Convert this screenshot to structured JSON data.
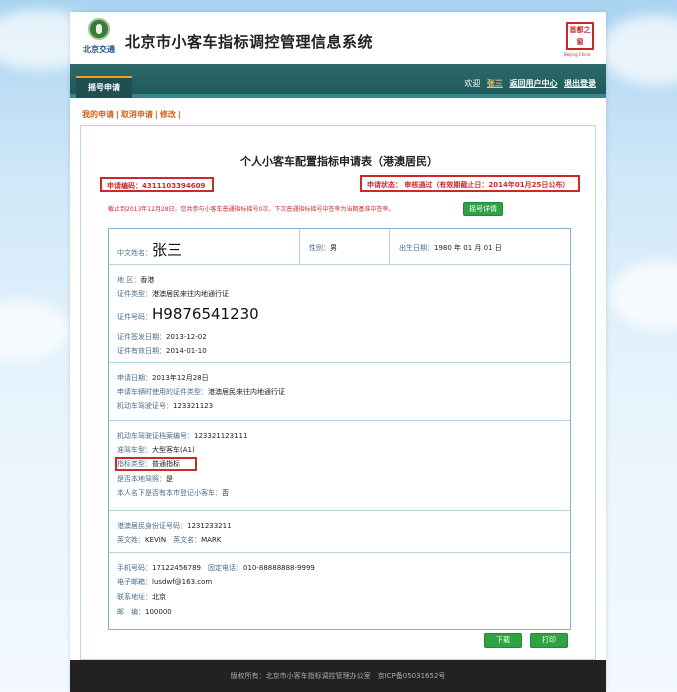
{
  "header": {
    "logo_text": "北京交通",
    "system_title": "北京市小客车指标调控管理信息系统",
    "seal_text": "首都之窗",
    "seal_sub": "Beijing China"
  },
  "nav": {
    "active_tab": "摇号申请",
    "welcome": "欢迎",
    "username": "张三",
    "return_link": "返回用户中心",
    "logout_link": "退出登录"
  },
  "breadcrumb": {
    "my_application": "我的申请",
    "cancel_application": "取消申请",
    "modify": "修改"
  },
  "form": {
    "title": "个人小客车配置指标申请表（港澳居民）",
    "application_no": "申请编码：4311103394609",
    "status": "申请状态：  审核通过（有效期截止日：2014年01月25日公布）",
    "notice": "截止到2013年12月28日，您共参与小客车普通指标摇号0次，下次普通指标摇号中签率为当期基准中签率。",
    "detail_button": "摇号详情"
  },
  "section1": {
    "name_label": "中文姓名：",
    "name_value": "张三",
    "gender_label": "性别：",
    "gender_value": "男",
    "birth_label": "出生日期：",
    "birth_value": "1980 年 01 月 01 日"
  },
  "section2": {
    "region_label": "地 区：",
    "region_value": "香港",
    "doc_type_label": "证件类型：",
    "doc_type_value": "港澳居民来往内地通行证",
    "doc_no_label": "证件号码：",
    "doc_no_value": "H9876541230",
    "issue_date_label": "证件签发日期：",
    "issue_date_value": "2013-12-02",
    "expire_date_label": "证件有效日期：",
    "expire_date_value": "2014-01-10"
  },
  "section3": {
    "apply_date_label": "申请日期：",
    "apply_date_value": "2013年12月28日",
    "used_doc_label": "申请车辆时使用的证件类型：",
    "used_doc_value": "港澳居民来往内地通行证",
    "license_label": "机动车驾驶证号：",
    "license_value": "123321123"
  },
  "section4": {
    "vehicle_license_label": "机动车驾驶证档案编号：",
    "vehicle_license_value": "123321123111",
    "car_type_label": "准驾车型：",
    "car_type_value": "大型客车(A1)",
    "quota_type_label": "指标类型：",
    "quota_type_value": "普通指标",
    "local_label": "是否本地驾照：",
    "local_value": "是",
    "has_car_label": "本人名下是否有本市登记小客车：",
    "has_car_value": "否"
  },
  "section5": {
    "pass_label": "港澳居民身份证号码：",
    "pass_value": "1231233211",
    "en_name_label": "英文姓：",
    "en_name_value": "KEVIN",
    "en_given_label": "英文名：",
    "en_given_value": "MARK"
  },
  "section6": {
    "mobile_label": "手机号码：",
    "mobile_value": "17122456789",
    "phone_label": "固定电话：",
    "phone_value": "010-88888888-9999",
    "email_label": "电子邮箱：",
    "email_value": "lusdwf@163.com",
    "address_label": "联系地址：",
    "address_value": "北京",
    "postcode_label": "邮　编：",
    "postcode_value": "100000"
  },
  "actions": {
    "download": "下载",
    "print": "打印"
  },
  "footer": {
    "text": "版权所有：北京市小客车指标调控管理办公室　京ICP备05031652号"
  },
  "colors": {
    "nav_bg": "#1f5a5c",
    "accent_orange": "#d0631c",
    "highlight_red": "#c92b2b",
    "button_green": "#2fa344"
  }
}
